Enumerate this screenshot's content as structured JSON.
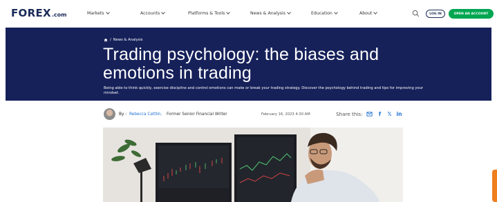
{
  "nav": {
    "logo_brand": "FOREX",
    "logo_tld": ".com",
    "items": [
      {
        "label": "Markets"
      },
      {
        "label": "Accounts"
      },
      {
        "label": "Platforms & Tools"
      },
      {
        "label": "News & Analysis"
      },
      {
        "label": "Education"
      },
      {
        "label": "About"
      }
    ],
    "login_label": "LOG IN",
    "open_account_label": "OPEN AN ACCOUNT"
  },
  "hero": {
    "breadcrumb": "News & Analysis",
    "title": "Trading psychology: the biases and emotions in trading",
    "subtitle": "Being able to think quickly, exercise discipline and control emotions can make or break your trading strategy. Discover the psychology behind trading and tips for improving your mindset."
  },
  "byline": {
    "by_label": "By :",
    "author": "Rebecca Cattlin,",
    "author_role": "Former Senior Financial Writer",
    "date": "February 16, 2023 4:30 AM",
    "share_label": "Share this:",
    "share_icons": [
      "mail-icon",
      "facebook-icon",
      "x-icon",
      "linkedin-icon"
    ]
  },
  "colors": {
    "brand_navy": "#16215a",
    "cta_green": "#00a651",
    "link_blue": "#1d6fd1",
    "side_tab_orange": "#f07f1e"
  }
}
